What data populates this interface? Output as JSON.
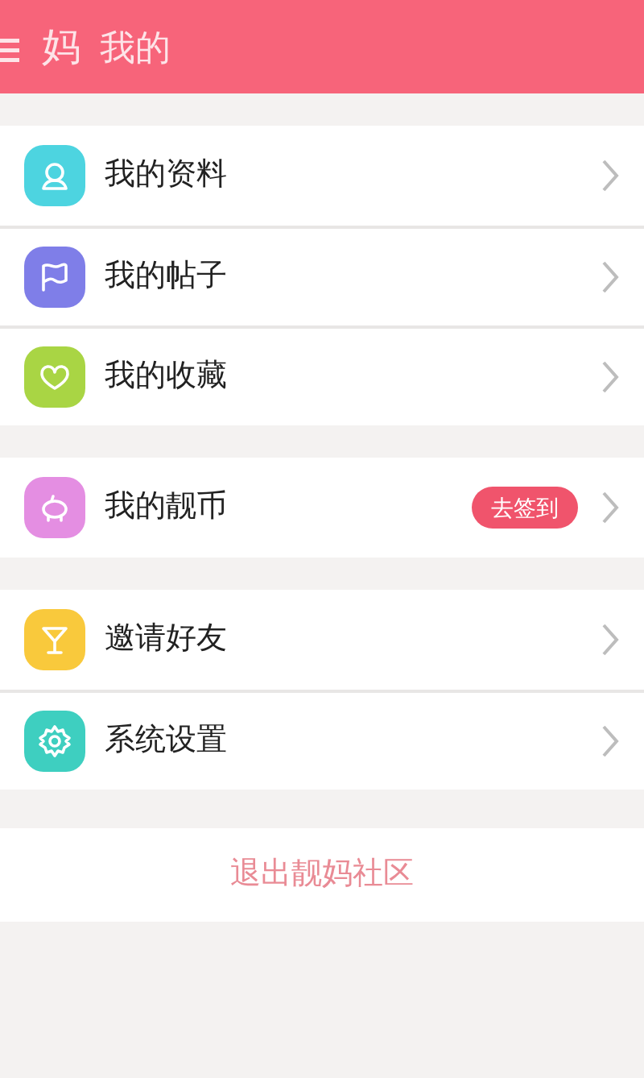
{
  "header": {
    "app_name": "妈",
    "title": "我的"
  },
  "groups": [
    [
      {
        "label": "我的资料",
        "color": "#4dd4e0"
      },
      {
        "label": "我的帖子",
        "color": "#7f7ee8"
      },
      {
        "label": "我的收藏",
        "color": "#a9d544"
      }
    ],
    [
      {
        "label": "我的靓币",
        "color": "#e48ee2",
        "badge": "去签到"
      }
    ],
    [
      {
        "label": "邀请好友",
        "color": "#f9c93c"
      },
      {
        "label": "系统设置",
        "color": "#3ecfc0"
      }
    ]
  ],
  "logout": "退出靓妈社区"
}
